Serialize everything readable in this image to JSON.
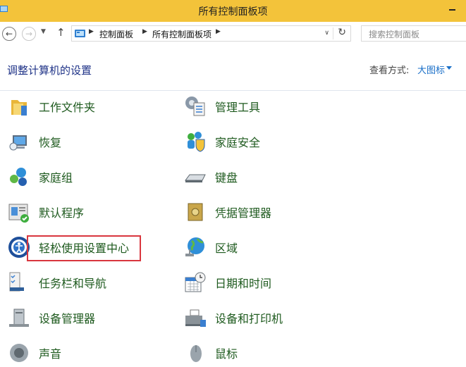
{
  "window": {
    "title": "所有控制面板项"
  },
  "nav": {
    "breadcrumbs": [
      "控制面板",
      "所有控制面板项"
    ],
    "search_placeholder": "搜索控制面板"
  },
  "header": {
    "title": "调整计算机的设置",
    "view_by_label": "查看方式:",
    "view_by_value": "大图标"
  },
  "items": [
    {
      "label": "工作文件夹",
      "icon": "work-folders-icon"
    },
    {
      "label": "管理工具",
      "icon": "admin-tools-icon"
    },
    {
      "label": "恢复",
      "icon": "recovery-icon"
    },
    {
      "label": "家庭安全",
      "icon": "family-safety-icon"
    },
    {
      "label": "家庭组",
      "icon": "homegroup-icon"
    },
    {
      "label": "键盘",
      "icon": "keyboard-icon"
    },
    {
      "label": "默认程序",
      "icon": "default-programs-icon"
    },
    {
      "label": "凭据管理器",
      "icon": "credential-manager-icon"
    },
    {
      "label": "轻松使用设置中心",
      "icon": "ease-of-access-icon",
      "highlighted": true
    },
    {
      "label": "区域",
      "icon": "region-icon"
    },
    {
      "label": "任务栏和导航",
      "icon": "taskbar-navigation-icon"
    },
    {
      "label": "日期和时间",
      "icon": "date-time-icon"
    },
    {
      "label": "设备管理器",
      "icon": "device-manager-icon"
    },
    {
      "label": "设备和打印机",
      "icon": "devices-printers-icon"
    },
    {
      "label": "声音",
      "icon": "sound-icon"
    },
    {
      "label": "鼠标",
      "icon": "mouse-icon"
    }
  ],
  "colors": {
    "titlebar": "#f3c33a",
    "link_green": "#1e5a1e",
    "title_blue": "#1e3287",
    "highlight_red": "#d9363e"
  }
}
